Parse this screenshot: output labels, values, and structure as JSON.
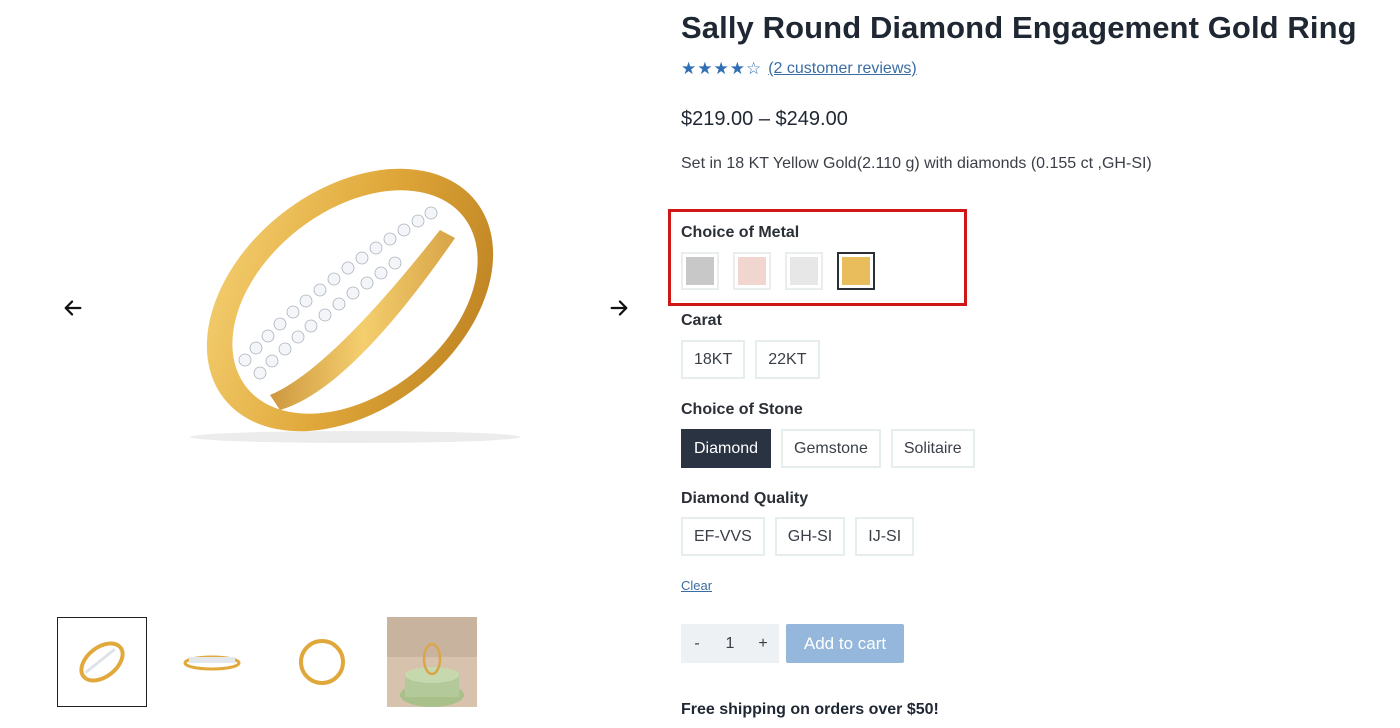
{
  "product": {
    "title": "Sally Round Diamond Engagement Gold Ring",
    "rating": {
      "stars_filled": "★★★★",
      "stars_empty": "☆",
      "value": 4,
      "max": 5,
      "reviews_text": "(2 customer reviews)"
    },
    "price": "$219.00 – $249.00",
    "description": "Set in 18 KT Yellow Gold(2.110 g) with diamonds (0.155 ct ,GH-SI)"
  },
  "gallery": {
    "prev_icon": "arrow-left-icon",
    "next_icon": "arrow-right-icon",
    "thumbnail_count": 4,
    "active_thumbnail": 0
  },
  "metal": {
    "label": "Choice of Metal",
    "options": [
      {
        "name": "white-gold",
        "color": "#c8c8c8"
      },
      {
        "name": "rose-gold",
        "color": "#f1d6d0"
      },
      {
        "name": "platinum",
        "color": "#e7e7e7"
      },
      {
        "name": "yellow-gold",
        "color": "#e9bc5c"
      }
    ],
    "selected": 3
  },
  "carat": {
    "label": "Carat",
    "options": [
      "18KT",
      "22KT"
    ]
  },
  "stone": {
    "label": "Choice of Stone",
    "options": [
      "Diamond",
      "Gemstone",
      "Solitaire"
    ],
    "selected": 0
  },
  "quality": {
    "label": "Diamond Quality",
    "options": [
      "EF-VVS",
      "GH-SI",
      "IJ-SI"
    ]
  },
  "clear_label": "Clear",
  "cart": {
    "minus": "-",
    "quantity": "1",
    "plus": "+",
    "add_label": "Add to cart"
  },
  "shipping_text": "Free shipping on orders over $50!",
  "colors": {
    "accent": "#2f6fb3",
    "highlight": "#d01717",
    "selected_option_bg": "#2a3342",
    "add_to_cart_bg": "#94b7db"
  }
}
